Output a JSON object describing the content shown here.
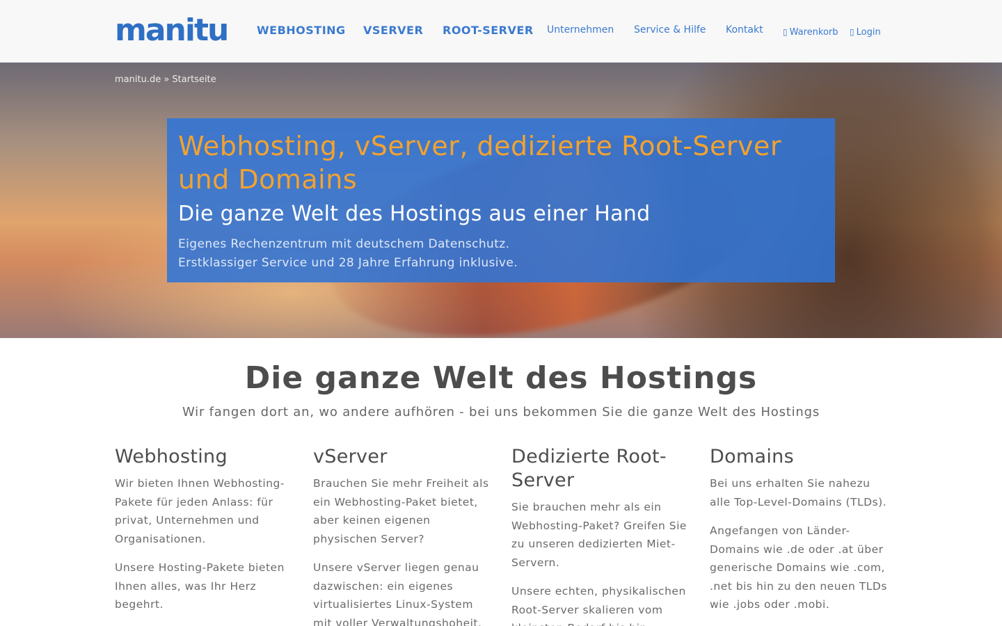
{
  "header": {
    "logo": "manitu",
    "nav_main": [
      "WEBHOSTING",
      "VSERVER",
      "ROOT-SERVER"
    ],
    "nav_sub": [
      "Unternehmen",
      "Service & Hilfe",
      "Kontakt"
    ],
    "cart": {
      "icon": "cart-icon",
      "label": "Warenkorb"
    },
    "login": {
      "icon": "user-icon",
      "label": "Login"
    }
  },
  "hero": {
    "breadcrumb": "manitu.de » Startseite",
    "title_line1": "Webhosting, vServer, dedizierte Root-Server",
    "title_line2": "und Domains",
    "subtitle": "Die ganze Welt des Hostings aus einer Hand",
    "text_line1": "Eigenes Rechenzentrum mit deutschem Datenschutz.",
    "text_line2": "Erstklassiger Service und 28 Jahre Erfahrung inklusive."
  },
  "intro": {
    "title": "Die ganze Welt des Hostings",
    "subtitle": "Wir fangen dort an, wo andere aufhören - bei uns bekommen Sie die ganze Welt des Hostings"
  },
  "columns": [
    {
      "title": "Webhosting",
      "p1": "Wir bieten Ihnen Webhosting-Pakete für jeden Anlass: für privat, Unternehmen und Organisationen.",
      "p2": "Unsere Hosting-Pakete bieten Ihnen alles, was Ihr Herz begehrt."
    },
    {
      "title": "vServer",
      "p1": "Brauchen Sie mehr Freiheit als ein Webhosting-Paket bietet, aber keinen eigenen physischen Server?",
      "p2": "Unsere vServer liegen genau dazwischen: ein eigenes virtualisiertes Linux-System mit voller Verwaltungshoheit."
    },
    {
      "title": "Dedizierte Root-Server",
      "p1": "Sie brauchen mehr als ein Webhosting-Paket? Greifen Sie zu unseren dedizierten Miet-Servern.",
      "p2": "Unsere echten, physikalischen Root-Server skalieren vom kleinsten Bedarf bis hin"
    },
    {
      "title": "Domains",
      "p1": "Bei uns erhalten Sie nahezu alle Top-Level-Domains (TLDs).",
      "p2": "Angefangen von Länder-Domains wie .de oder .at über generische Domains wie .com, .net bis hin zu den neuen TLDs wie .jobs oder .mobi."
    }
  ],
  "colors": {
    "brand_blue": "#2f6fc4",
    "hero_box": "#3074d6",
    "hero_title": "#f2a230"
  }
}
